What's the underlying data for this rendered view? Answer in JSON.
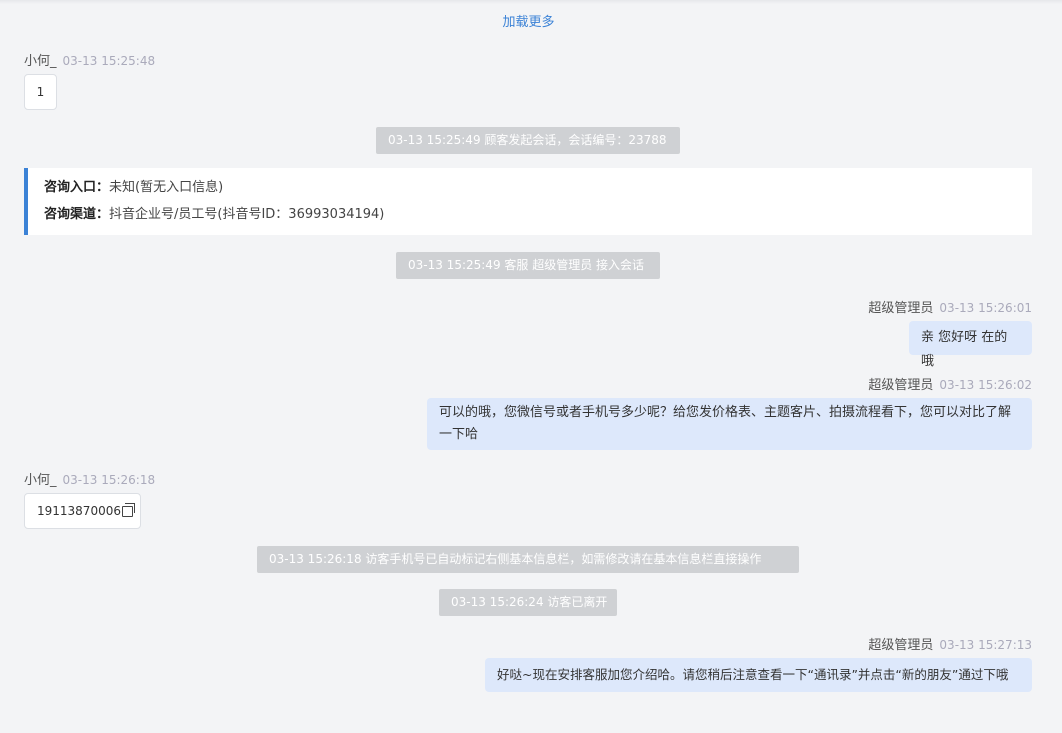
{
  "load_more": "加载更多",
  "messages": [
    {
      "sender": "小何_",
      "time": "03-13 15:25:48",
      "text": "1"
    },
    {
      "system": "03-13 15:25:49 顾客发起会话，会话编号：23788"
    },
    {
      "system": "03-13 15:25:49 客服 超级管理员 接入会话"
    },
    {
      "sender": "超级管理员",
      "time": "03-13 15:26:01",
      "text": "亲 您好呀 在的哦"
    },
    {
      "sender": "超级管理员",
      "time": "03-13 15:26:02",
      "text": "可以的哦，您微信号或者手机号多少呢？给您发价格表、主题客片、拍摄流程看下，您可以对比了解一下哈"
    },
    {
      "sender": "小何_",
      "time": "03-13 15:26:18",
      "text": "19113870006"
    },
    {
      "system": "03-13 15:26:18 访客手机号已自动标记右侧基本信息栏，如需修改请在基本信息栏直接操作"
    },
    {
      "system": "03-13 15:26:24 访客已离开"
    },
    {
      "sender": "超级管理员",
      "time": "03-13 15:27:13",
      "text": "好哒~现在安排客服加您介绍哈。请您稍后注意查看一下“通讯录”并点击“新的朋友”通过下哦"
    }
  ],
  "info_card": {
    "entry_label": "咨询入口：",
    "entry_value": "未知(暂无入口信息)",
    "channel_label": "咨询渠道：",
    "channel_value": "抖音企业号/员工号(抖音号ID：36993034194)"
  },
  "colors": {
    "accent": "#3b82d6",
    "bubble_right": "#dde8fb",
    "system_bg": "#cfd1d4",
    "background": "#f3f4f6"
  },
  "icons": {
    "copy": "copy-icon"
  }
}
